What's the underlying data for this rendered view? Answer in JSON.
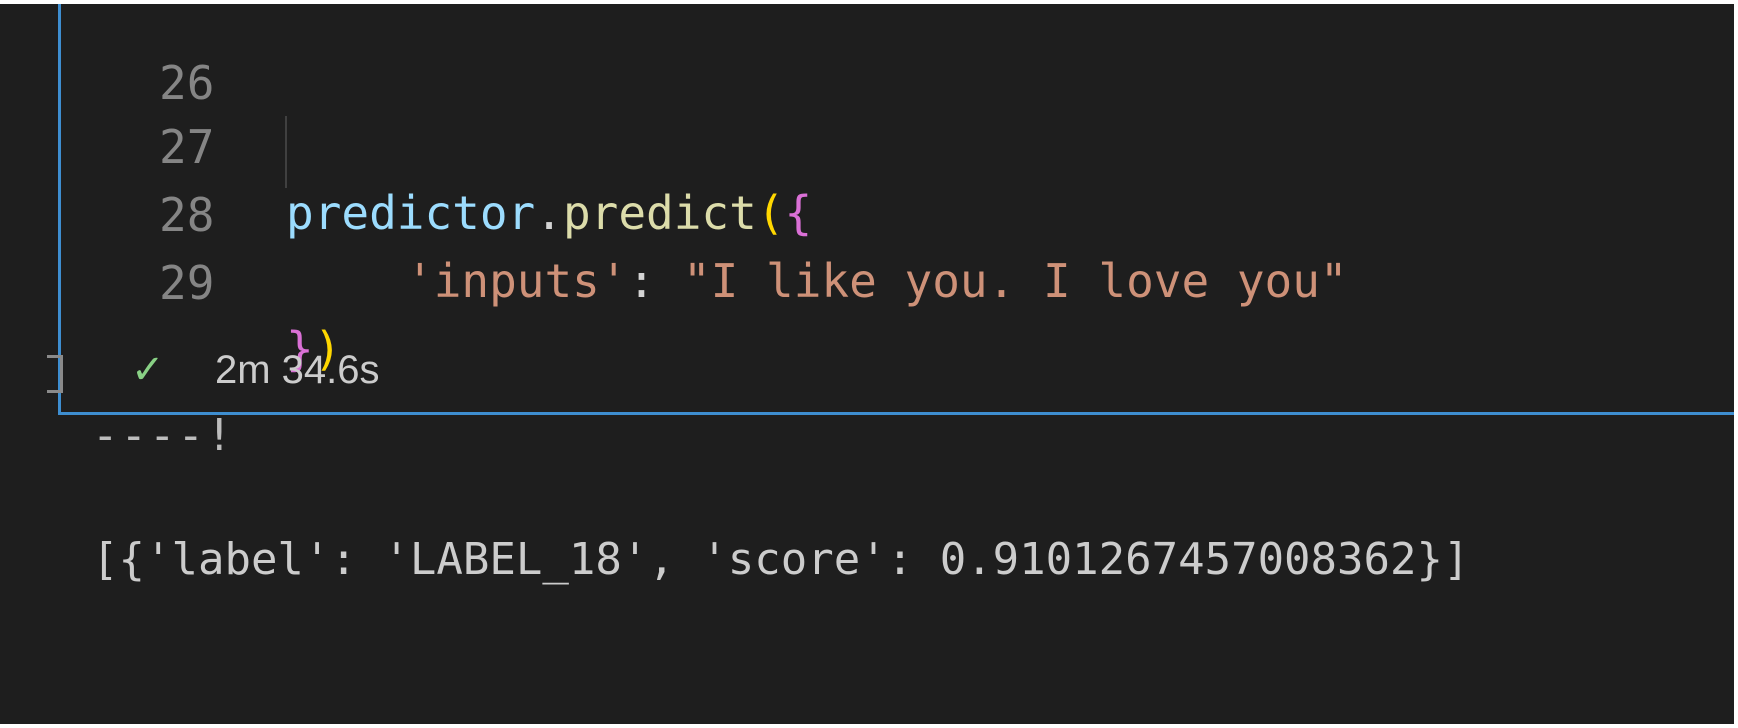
{
  "editor": {
    "lines": [
      {
        "number": "26"
      },
      {
        "number": "27"
      },
      {
        "number": "28"
      },
      {
        "number": "29"
      }
    ],
    "code": {
      "l27_var": "predictor",
      "l27_dot": ".",
      "l27_fn": "predict",
      "l27_paren": "(",
      "l27_brace": "{",
      "l28_key": "'inputs'",
      "l28_colon": ": ",
      "l28_value": "\"I like you. I love you\"",
      "l29_brace": "}",
      "l29_paren": ")"
    }
  },
  "status": {
    "check_glyph": "✓",
    "elapsed": "2m 34.6s"
  },
  "output": {
    "progress": "----!",
    "result": "[{'label': 'LABEL_18', 'score': 0.9101267457008362}]"
  },
  "colors": {
    "background": "#1e1e1e",
    "cell_border": "#3e8ed0",
    "success": "#89d185",
    "string": "#ce9178",
    "variable": "#9cdcfe",
    "function": "#dcdcaa"
  }
}
